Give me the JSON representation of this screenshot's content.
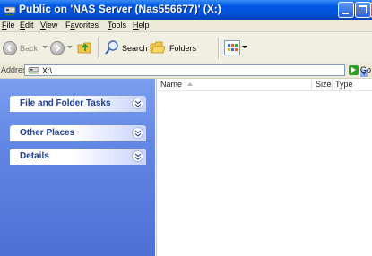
{
  "window": {
    "title": "Public on 'NAS Server (Nas556677)' (X:)"
  },
  "menu": {
    "items": [
      "File",
      "Edit",
      "View",
      "Favorites",
      "Tools",
      "Help"
    ],
    "accel": [
      "F",
      "E",
      "V",
      "a",
      "T",
      "H"
    ]
  },
  "toolbar": {
    "back_label": "Back",
    "search_label": "Search",
    "folders_label": "Folders"
  },
  "address": {
    "label": "Address",
    "value": "X:\\",
    "go_label": "Go"
  },
  "tasks": {
    "groups": [
      {
        "title": "File and Folder Tasks"
      },
      {
        "title": "Other Places"
      },
      {
        "title": "Details"
      }
    ]
  },
  "list": {
    "columns": {
      "name": "Name",
      "size": "Size",
      "type": "Type"
    }
  },
  "colors": {
    "titlebar": "#0058e6",
    "taskpane": "#6185e3",
    "task_title": "#1f3e96"
  }
}
